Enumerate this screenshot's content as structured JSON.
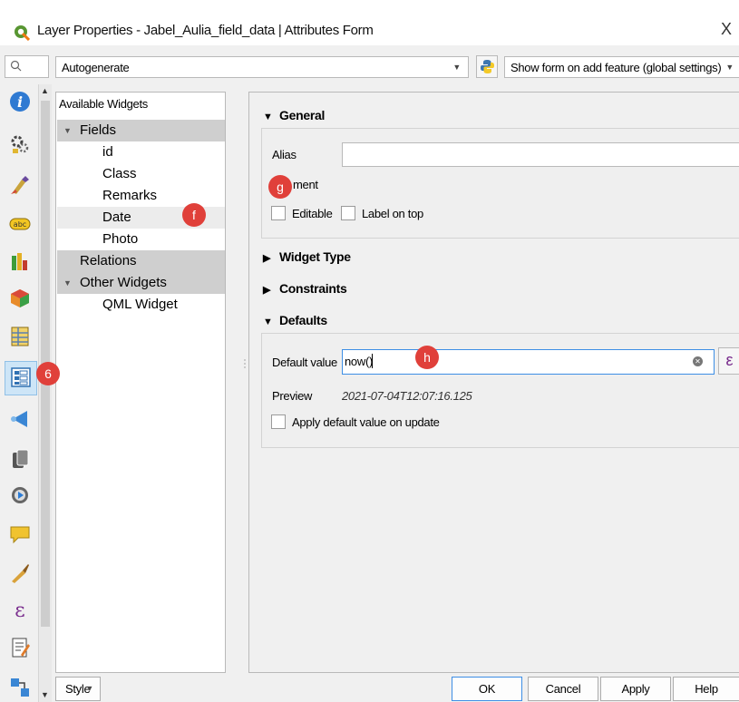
{
  "window": {
    "title": "Layer Properties - Jabel_Aulia_field_data | Attributes Form",
    "close_glyph": "X"
  },
  "toolbar": {
    "layout_value": "Autogenerate",
    "suppress_value": "Show form on add feature (global settings)"
  },
  "sidebar": {
    "icons": [
      "information-icon",
      "source-icon",
      "symbology-icon",
      "labels-icon",
      "diagrams-icon",
      "3d-view-icon",
      "fields-icon",
      "attributes-form-icon",
      "joins-icon",
      "auxiliary-storage-icon",
      "actions-icon",
      "display-icon",
      "rendering-icon",
      "variables-icon",
      "metadata-icon",
      "dependencies-icon"
    ]
  },
  "tree": {
    "header": "Available Widgets",
    "items": [
      {
        "label": "Fields",
        "level": 0,
        "expanded": true,
        "selected": true
      },
      {
        "label": "id",
        "level": 2
      },
      {
        "label": "Class",
        "level": 2
      },
      {
        "label": "Remarks",
        "level": 2
      },
      {
        "label": "Date",
        "level": 2,
        "hover": true
      },
      {
        "label": "Photo",
        "level": 2
      },
      {
        "label": "Relations",
        "level": 0,
        "selected": true
      },
      {
        "label": "Other Widgets",
        "level": 0,
        "expanded": true,
        "selected": true
      },
      {
        "label": "QML Widget",
        "level": 2
      }
    ]
  },
  "props": {
    "general": {
      "title": "General",
      "alias_label": "Alias",
      "alias_value": "",
      "comment_label": "ment",
      "editable_label": "Editable",
      "label_on_top_label": "Label on top"
    },
    "widget_type": {
      "title": "Widget Type"
    },
    "constraints": {
      "title": "Constraints"
    },
    "defaults": {
      "title": "Defaults",
      "default_value_label": "Default value",
      "default_value": "now()",
      "preview_label": "Preview",
      "preview_value": "2021-07-04T12:07:16.125",
      "apply_on_update_label": "Apply default value on update",
      "expression_glyph": "ε"
    }
  },
  "buttons": {
    "style": "Style",
    "ok": "OK",
    "cancel": "Cancel",
    "apply": "Apply",
    "help": "Help"
  },
  "markers": {
    "six": "6",
    "f": "f",
    "g": "g",
    "h": "h"
  },
  "colors": {
    "marker": "#e0403a",
    "selection": "#cfcfcf",
    "focus": "#3d8ee5",
    "active_nav": "#cde5f7"
  }
}
